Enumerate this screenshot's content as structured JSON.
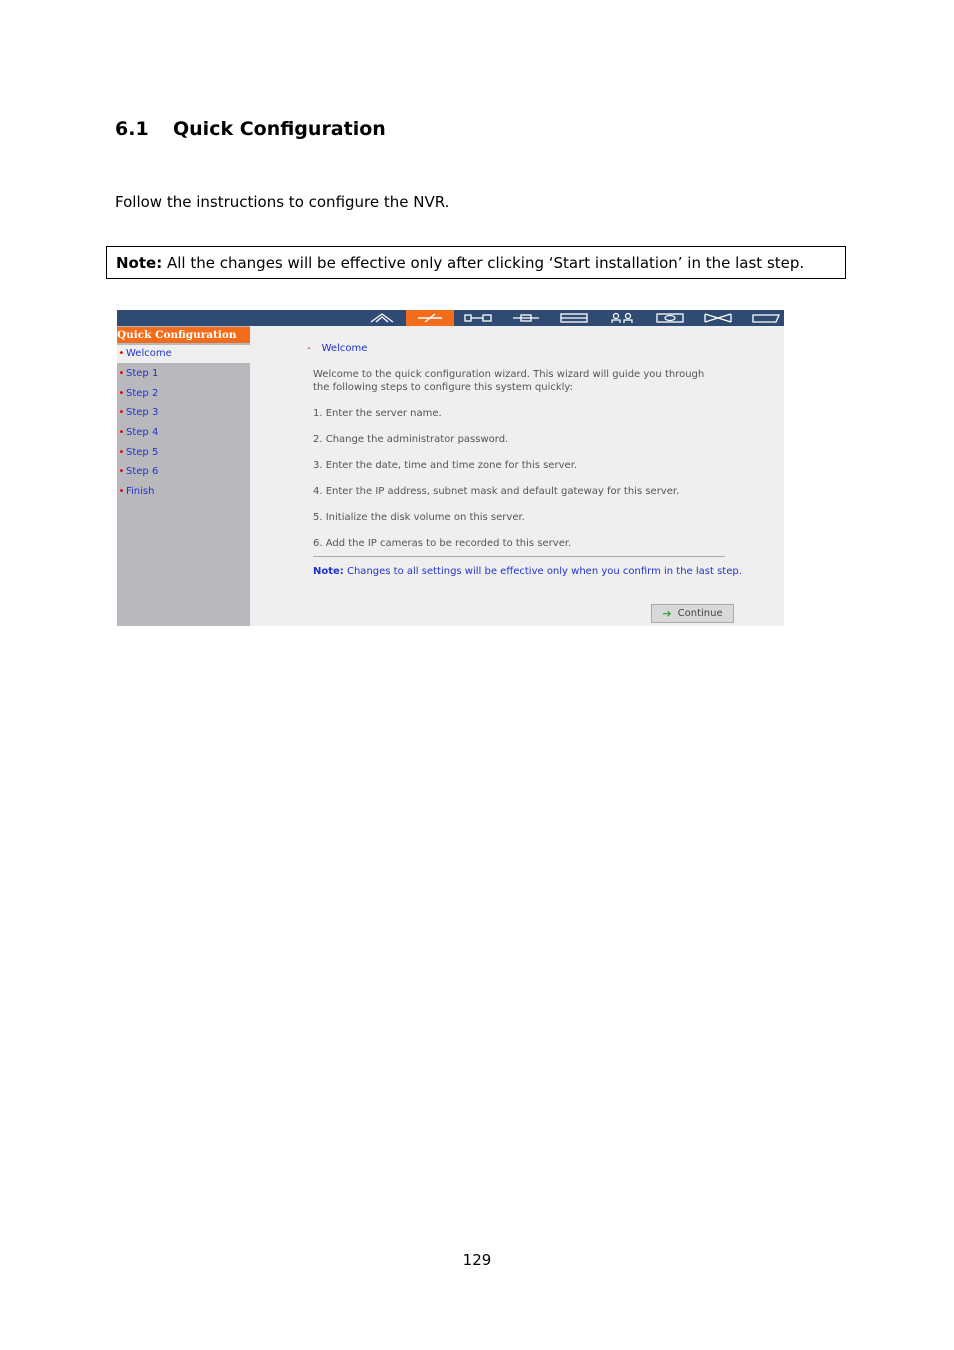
{
  "section": {
    "number": "6.1",
    "title": "Quick Configuration"
  },
  "intro": "Follow the instructions to configure the NVR.",
  "note": {
    "label": "Note:",
    "text": " All the changes will be effective only after clicking ‘Start installation’ in the last step."
  },
  "screenshot": {
    "topbar_icons": [
      "home-icon",
      "quick-config-icon",
      "system-icon",
      "network-icon",
      "disk-icon",
      "users-icon",
      "camera-icon",
      "bandwidth-icon",
      "logs-icon"
    ],
    "active_icon": "quick-config-icon",
    "colors": {
      "topbar": "#2f4b73",
      "accent": "#f36c1c",
      "sidebar": "#b9b8bd",
      "link": "#2233cc",
      "bullet": "#e60000"
    },
    "sidebar": {
      "title": "Quick Configuration",
      "items": [
        {
          "label": "Welcome",
          "current": true
        },
        {
          "label": "Step 1"
        },
        {
          "label": "Step 2"
        },
        {
          "label": "Step 3"
        },
        {
          "label": "Step 4"
        },
        {
          "label": "Step 5"
        },
        {
          "label": "Step 6"
        },
        {
          "label": "Finish"
        }
      ]
    },
    "content": {
      "dash": "-",
      "title": "Welcome",
      "intro": "Welcome to the quick configuration wizard. This wizard will guide you through the following steps to configure this system quickly:",
      "steps": [
        "1. Enter the server name.",
        "2. Change the administrator password.",
        "3. Enter the date, time and time zone for this server.",
        "4. Enter the IP address, subnet mask and default gateway for this server.",
        "5. Initialize the disk volume on this server.",
        "6. Add the IP cameras to be recorded to this server."
      ],
      "note_label": "Note:",
      "note_text": " Changes to all settings will be effective only when you confirm in the last step.",
      "continue_label": "Continue"
    }
  },
  "page_number": "129"
}
